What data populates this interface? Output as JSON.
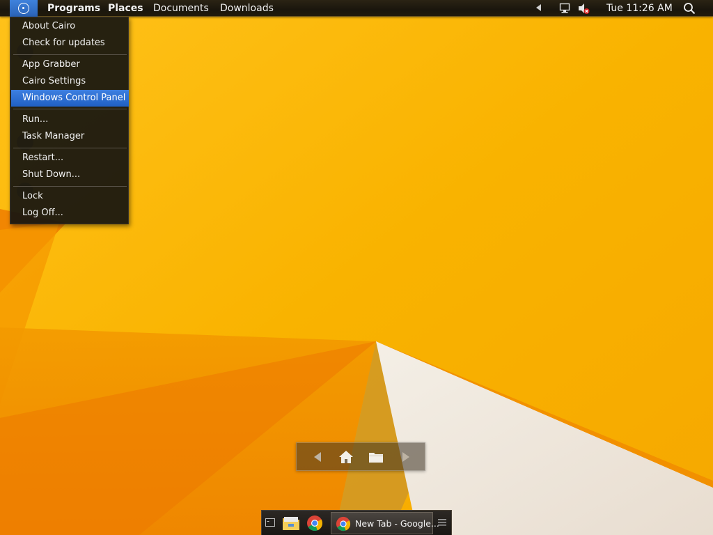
{
  "menubar": {
    "items": [
      {
        "label": "Programs"
      },
      {
        "label": "Places"
      },
      {
        "label": "Documents"
      },
      {
        "label": "Downloads"
      }
    ],
    "clock": "Tue 11:26 AM",
    "icons": [
      "cairo-logo-icon",
      "tray-expand-icon",
      "network-icon",
      "volume-muted-icon",
      "search-icon"
    ]
  },
  "cairo_menu": {
    "items": [
      {
        "label": "About Cairo"
      },
      {
        "label": "Check for updates"
      },
      {
        "label": "App Grabber"
      },
      {
        "label": "Cairo Settings"
      },
      {
        "label": "Windows Control Panel",
        "highlighted": true
      },
      {
        "label": "Run..."
      },
      {
        "label": "Task Manager"
      },
      {
        "label": "Restart..."
      },
      {
        "label": "Shut Down..."
      },
      {
        "label": "Lock"
      },
      {
        "label": "Log Off..."
      }
    ]
  },
  "nav_widget": {
    "icons": [
      "back-arrow-icon",
      "home-icon",
      "folder-icon",
      "forward-arrow-icon"
    ]
  },
  "taskbar": {
    "icons": [
      "desktop-toggle-icon",
      "file-explorer-icon",
      "chrome-icon",
      "taskbar-menu-icon"
    ],
    "active_task": {
      "label": "New Tab - Google..."
    }
  },
  "colors": {
    "accent_blue": "#2f6fd0",
    "wallpaper_yellow": "#f7b600",
    "wallpaper_orange": "#f08c00",
    "menu_bg": "#161410"
  }
}
